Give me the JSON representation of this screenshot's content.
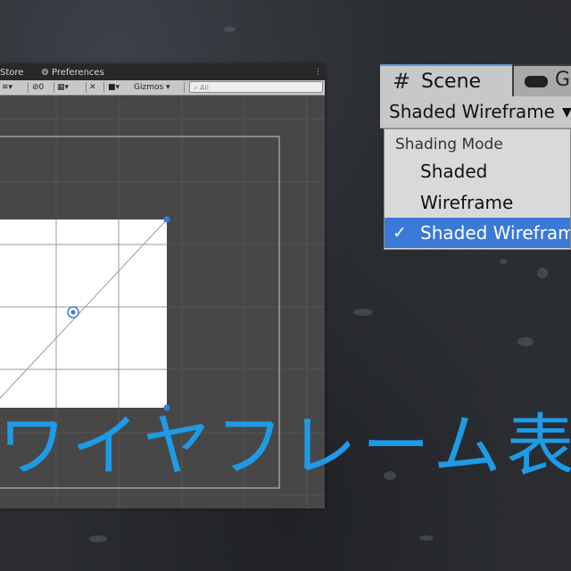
{
  "editor": {
    "tabs": [
      {
        "label": "Store"
      },
      {
        "label": "Preferences"
      }
    ],
    "toolbar": {
      "visibility_count": "0",
      "gizmos_label": "Gizmos",
      "search_placeholder": "All"
    }
  },
  "dropdown": {
    "scene_tab_label": "Scene",
    "game_tab_label": "Ga",
    "shading_mode_value": "Shaded Wireframe",
    "menu": {
      "header": "Shading Mode",
      "items": [
        {
          "label": "Shaded",
          "selected": false
        },
        {
          "label": "Wireframe",
          "selected": false
        },
        {
          "label": "Shaded Wireframe",
          "selected": true,
          "check": "✓"
        }
      ]
    }
  },
  "overlay": {
    "title": "ワイヤフレーム表"
  },
  "colors": {
    "accent": "#1e9be6",
    "selection": "#3a79d7",
    "handle": "#2f7de0"
  }
}
